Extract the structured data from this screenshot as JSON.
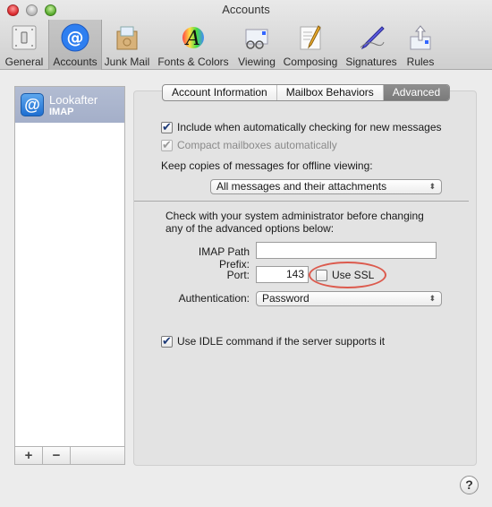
{
  "window": {
    "title": "Accounts"
  },
  "toolbar": {
    "items": [
      {
        "label": "General",
        "icon": "switch-icon",
        "active": false
      },
      {
        "label": "Accounts",
        "icon": "at-icon",
        "active": true
      },
      {
        "label": "Junk Mail",
        "icon": "junk-mail-icon",
        "active": false
      },
      {
        "label": "Fonts & Colors",
        "icon": "fonts-colors-icon",
        "active": false
      },
      {
        "label": "Viewing",
        "icon": "viewing-icon",
        "active": false
      },
      {
        "label": "Composing",
        "icon": "composing-icon",
        "active": false
      },
      {
        "label": "Signatures",
        "icon": "signatures-icon",
        "active": false
      },
      {
        "label": "Rules",
        "icon": "rules-icon",
        "active": false
      }
    ]
  },
  "accounts": {
    "items": [
      {
        "name": "Lookafter",
        "type": "IMAP",
        "selected": true
      }
    ],
    "add_label": "+",
    "remove_label": "−"
  },
  "tabs": [
    {
      "label": "Account Information",
      "selected": false
    },
    {
      "label": "Mailbox Behaviors",
      "selected": false
    },
    {
      "label": "Advanced",
      "selected": true
    }
  ],
  "advanced": {
    "include_auto_check": {
      "label": "Include when automatically checking for new messages",
      "checked": true
    },
    "compact_mailboxes": {
      "label": "Compact mailboxes automatically",
      "checked": true,
      "disabled": true
    },
    "keep_copies_label": "Keep copies of messages for offline viewing:",
    "keep_copies_value": "All messages and their attachments",
    "admin_note_line1": "Check with your system administrator before changing",
    "admin_note_line2": "any of the advanced options below:",
    "imap_prefix_label": "IMAP Path Prefix:",
    "imap_prefix_value": "",
    "port_label": "Port:",
    "port_value": "143",
    "use_ssl": {
      "label": "Use SSL",
      "checked": false
    },
    "auth_label": "Authentication:",
    "auth_value": "Password",
    "use_idle": {
      "label": "Use IDLE command if the server supports it",
      "checked": true
    }
  },
  "help_label": "?",
  "annotation_color": "#dc5a4d"
}
